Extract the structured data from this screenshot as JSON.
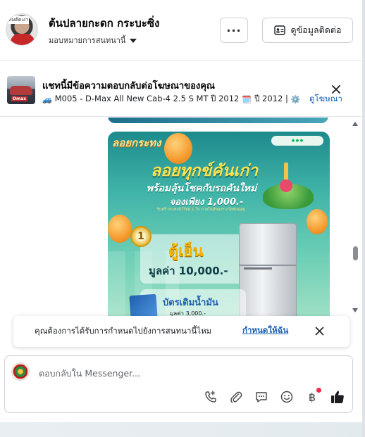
{
  "header": {
    "page_name": "ต้นปลายกะดก กระบะซิ่ง",
    "assign_label": "มอบหมายการสนทนานี้",
    "more_label": "···",
    "contact_button": "ดูข้อมูลติดต่อ",
    "avatar_tag": "ทีมตัดเงา"
  },
  "ad_reply": {
    "title": "แชทนี้มีข้อความตอบกลับต่อโฆษณาของคุณ",
    "subtitle": "M005 - D-Max All New Cab-4 2.5 S MT ปี 2012",
    "subtitle_tail": "ปี 2012 |",
    "view_ad_link": "ดูโฆษณา",
    "thumb_logo": "Dmax"
  },
  "promo": {
    "brand": "ลอยกระทง",
    "head1": "ลอยทุกข์คันเก่า",
    "head2": "พร้อมลุ้นโชคกับรถคันใหม่",
    "head3": "จองเพียง 1,000.-",
    "small": "รับฟรี กระทงนำโชค 1 ใบ ภายในมีของรางวัลซ่อนอยู่",
    "rank": "1",
    "prize_name": "ตู้เย็น",
    "prize_value": "มูลค่า 10,000.-",
    "fuel_name": "บัตรเติมน้ำมัน",
    "fuel_value": "มูลค่า 3,000.-"
  },
  "notification_prompt": {
    "text": "คุณต้องการได้รับการกำหนดไปยังการสนทนานี้ไหม",
    "action_link": "กำหนดให้ฉัน"
  },
  "composer": {
    "placeholder": "ตอบกลับใน Messenger...",
    "baht_symbol": "฿"
  },
  "colors": {
    "link": "#1a5fb4",
    "notification_dot": "#f02849",
    "promo_teal": "#3fb3a8"
  }
}
